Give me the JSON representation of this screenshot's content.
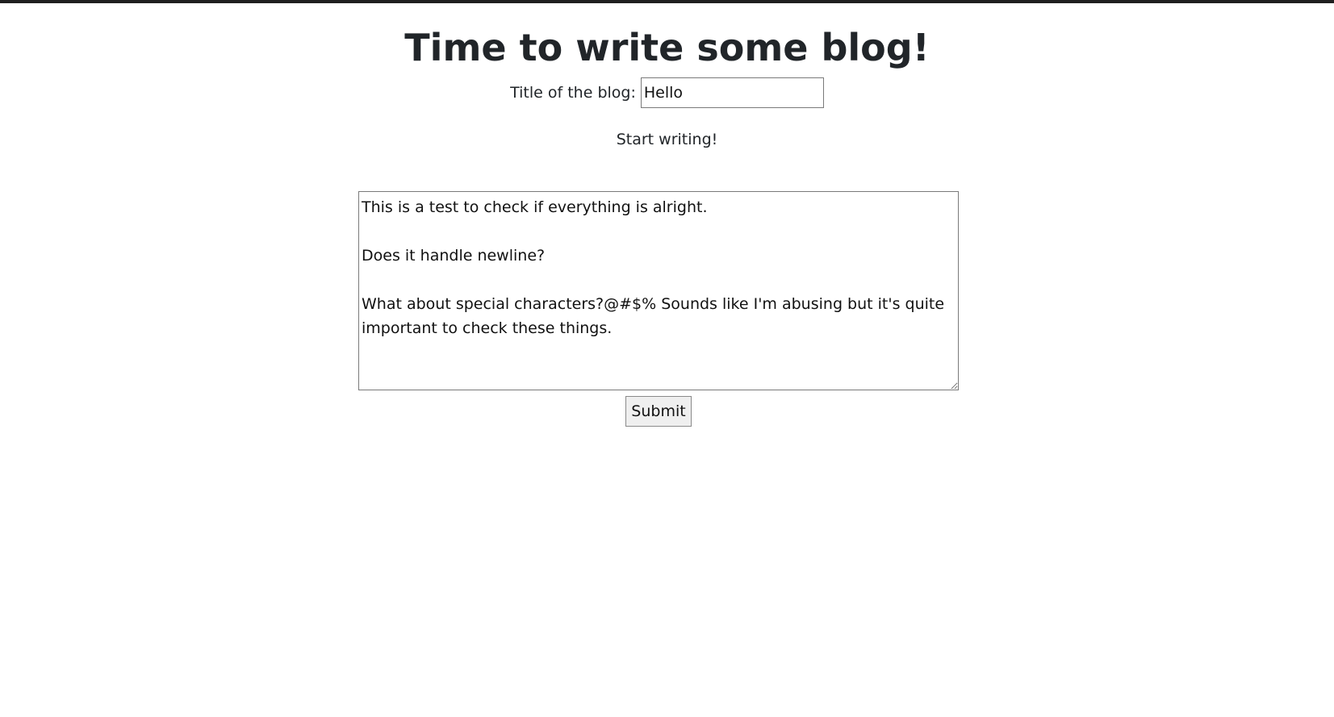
{
  "page": {
    "heading": "Time to write some blog!",
    "title_label": "Title of the blog:",
    "title_value": "Hello",
    "start_text": "Start writing!",
    "blog_content": "This is a test to check if everything is alright.\n\nDoes it handle newline?\n\nWhat about special characters?@#$% Sounds like I'm abusing but it's quite important to check these things.",
    "submit_label": "Submit"
  }
}
